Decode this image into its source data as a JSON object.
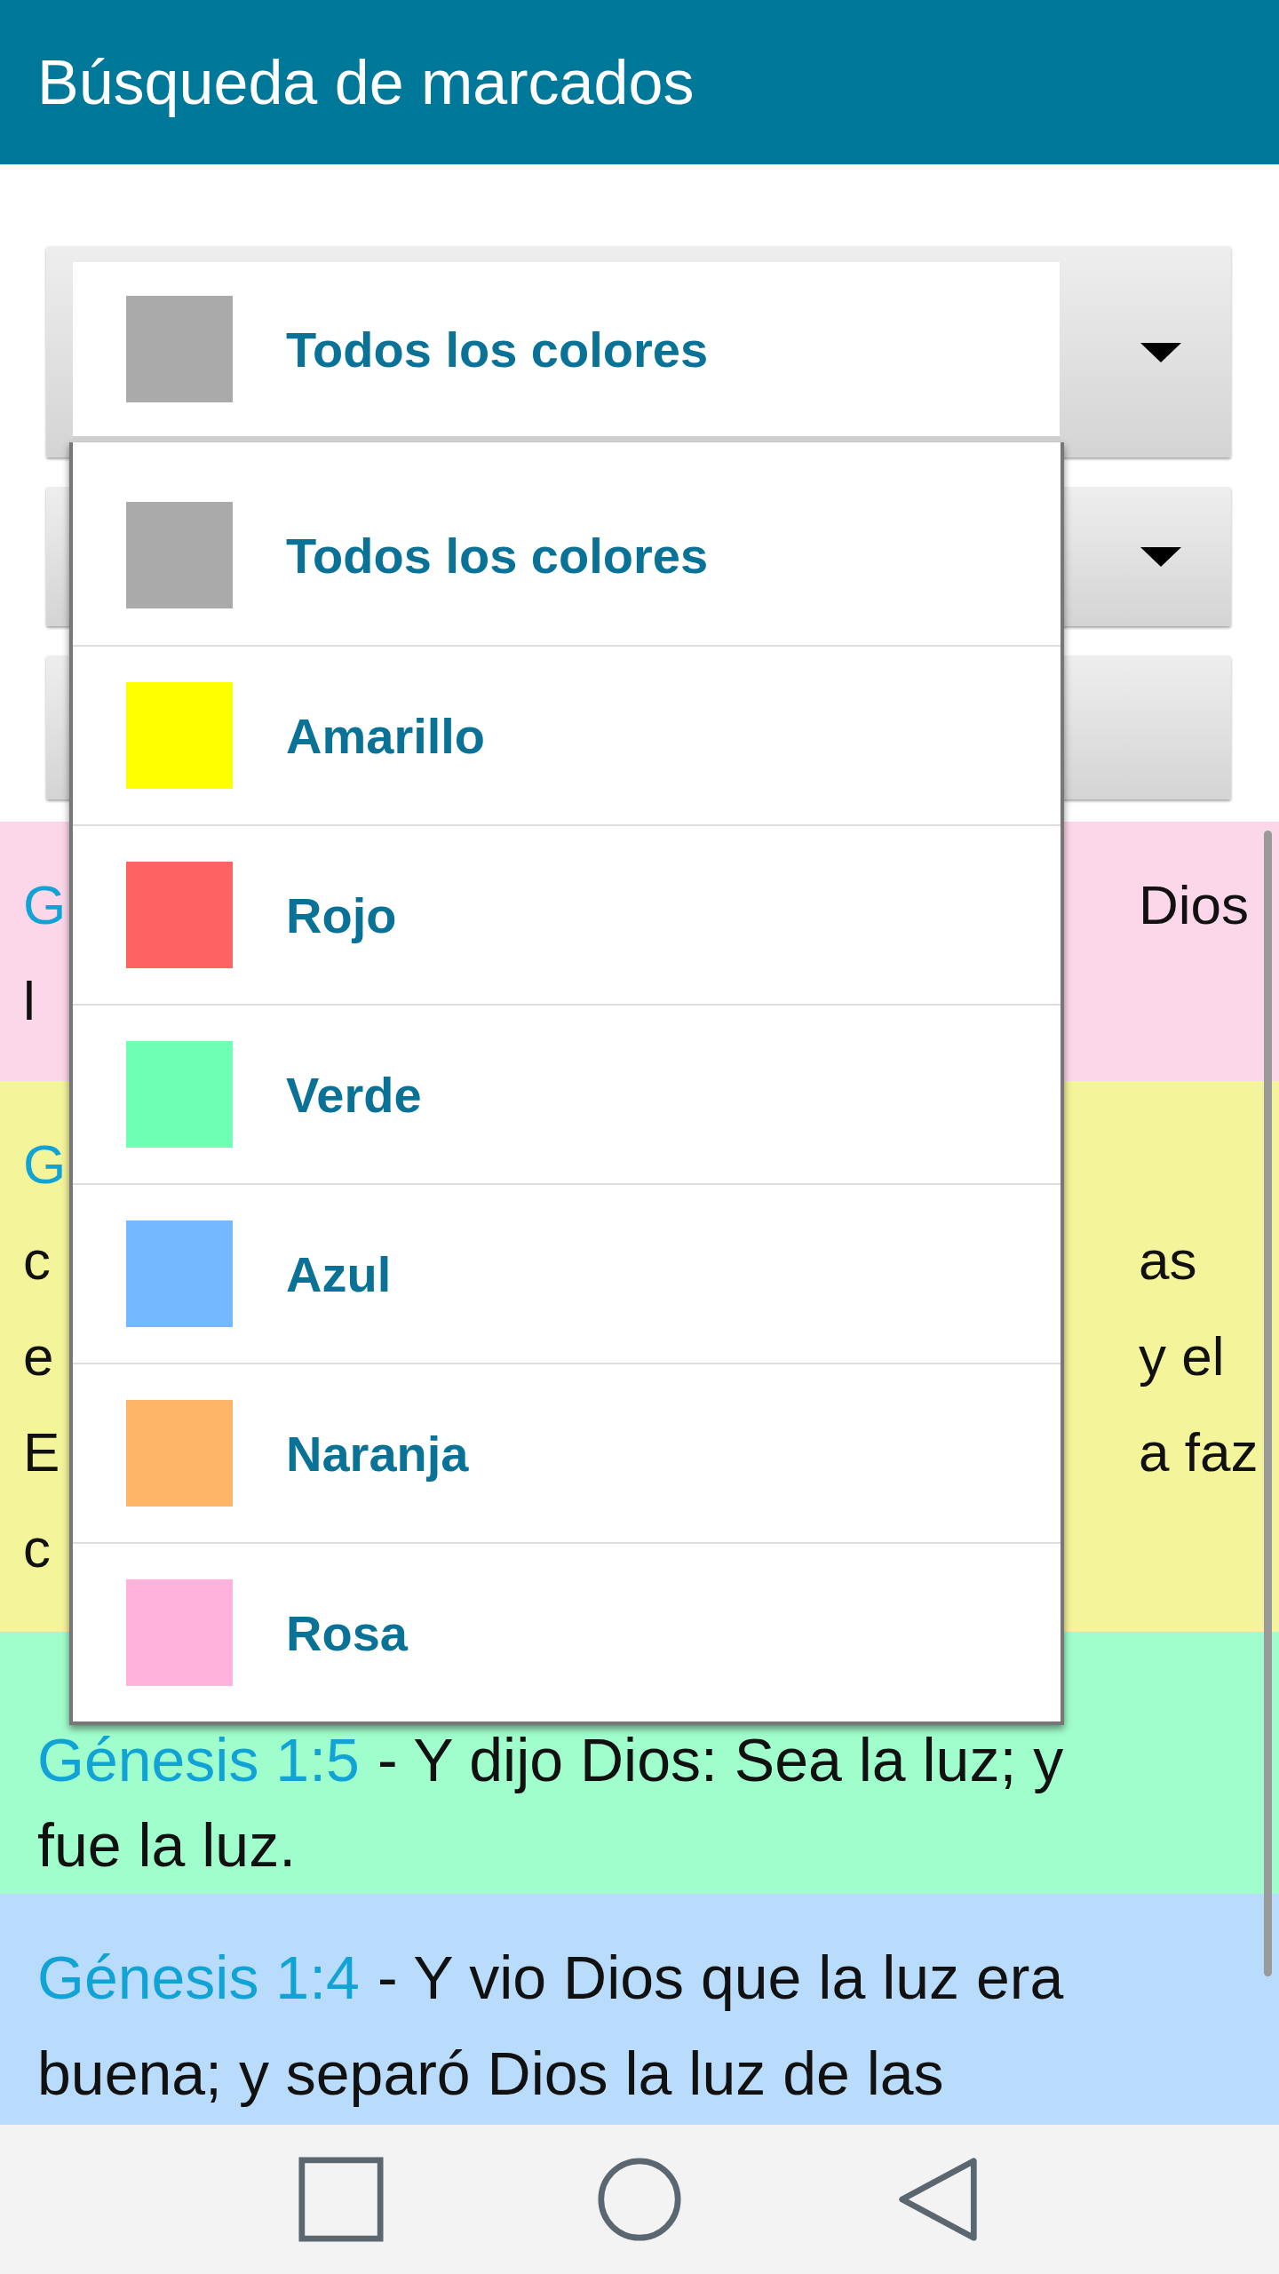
{
  "app_bar": {
    "title": "Búsqueda de marcados"
  },
  "color_spinner": {
    "value": "Todos los colores",
    "color": "#aaaaaa"
  },
  "color_options": [
    {
      "label": "Todos los colores",
      "color": "#aaaaaa"
    },
    {
      "label": "Amarillo",
      "color": "#ffff00"
    },
    {
      "label": "Rojo",
      "color": "#ff6262"
    },
    {
      "label": "Verde",
      "color": "#6fffb4"
    },
    {
      "label": "Azul",
      "color": "#74b9ff"
    },
    {
      "label": "Naranja",
      "color": "#feb567"
    },
    {
      "label": "Rosa",
      "color": "#ffb3dc"
    }
  ],
  "bookmarks": [
    {
      "kind": "covered",
      "color": "#fcd7ea",
      "lines": [
        {
          "start": "G",
          "start_is_reference": true,
          "end": "Dios"
        },
        {
          "start": "l",
          "start_is_reference": false
        }
      ]
    },
    {
      "kind": "covered",
      "color": "#f4f49b",
      "lines": [
        {
          "start": "G",
          "start_is_reference": true
        },
        {
          "start": "c",
          "start_is_reference": false,
          "end": "as"
        },
        {
          "start": "e",
          "start_is_reference": false,
          "end": "y el"
        },
        {
          "start": "E",
          "start_is_reference": false,
          "end": "a faz"
        },
        {
          "start": "c",
          "start_is_reference": false
        }
      ]
    },
    {
      "kind": "full",
      "color": "#a0fdcc",
      "reference": "Génesis 1:5",
      "lines": [
        "- Y dijo Dios: Sea la luz; y",
        "fue la luz."
      ]
    },
    {
      "kind": "full",
      "color": "#badcfc",
      "reference": "Génesis 1:4",
      "lines": [
        "- Y vio Dios que la luz era",
        "buena; y separó Dios la luz de las"
      ]
    }
  ]
}
